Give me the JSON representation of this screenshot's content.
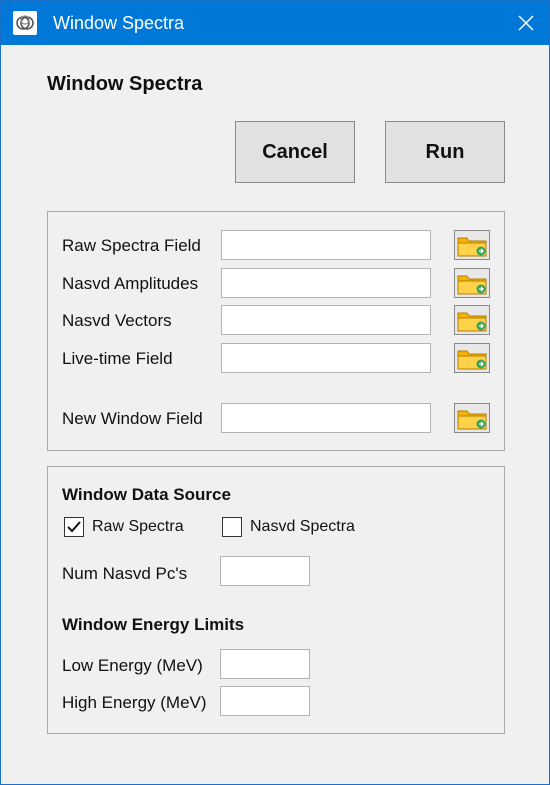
{
  "window": {
    "title": "Window Spectra",
    "heading": "Window Spectra"
  },
  "buttons": {
    "cancel": "Cancel",
    "run": "Run"
  },
  "fields": [
    {
      "label": "Raw Spectra Field",
      "value": ""
    },
    {
      "label": "Nasvd Amplitudes",
      "value": ""
    },
    {
      "label": "Nasvd Vectors",
      "value": ""
    },
    {
      "label": "Live-time Field",
      "value": ""
    },
    {
      "label": "New Window Field",
      "value": ""
    }
  ],
  "data_source": {
    "title": "Window Data Source",
    "raw_spectra_label": "Raw Spectra",
    "raw_spectra_checked": true,
    "nasvd_spectra_label": "Nasvd Spectra",
    "nasvd_spectra_checked": false,
    "num_pcs_label": "Num Nasvd Pc's",
    "num_pcs_value": ""
  },
  "energy_limits": {
    "title": "Window Energy Limits",
    "low_label": "Low Energy (MeV)",
    "low_value": "",
    "high_label": "High Energy (MeV)",
    "high_value": ""
  },
  "icons": {
    "app": "spectra-app-icon",
    "close": "close-icon",
    "browse": "folder-browse-icon"
  },
  "colors": {
    "titlebar": "#0078d7",
    "background": "#f0f0f0"
  }
}
